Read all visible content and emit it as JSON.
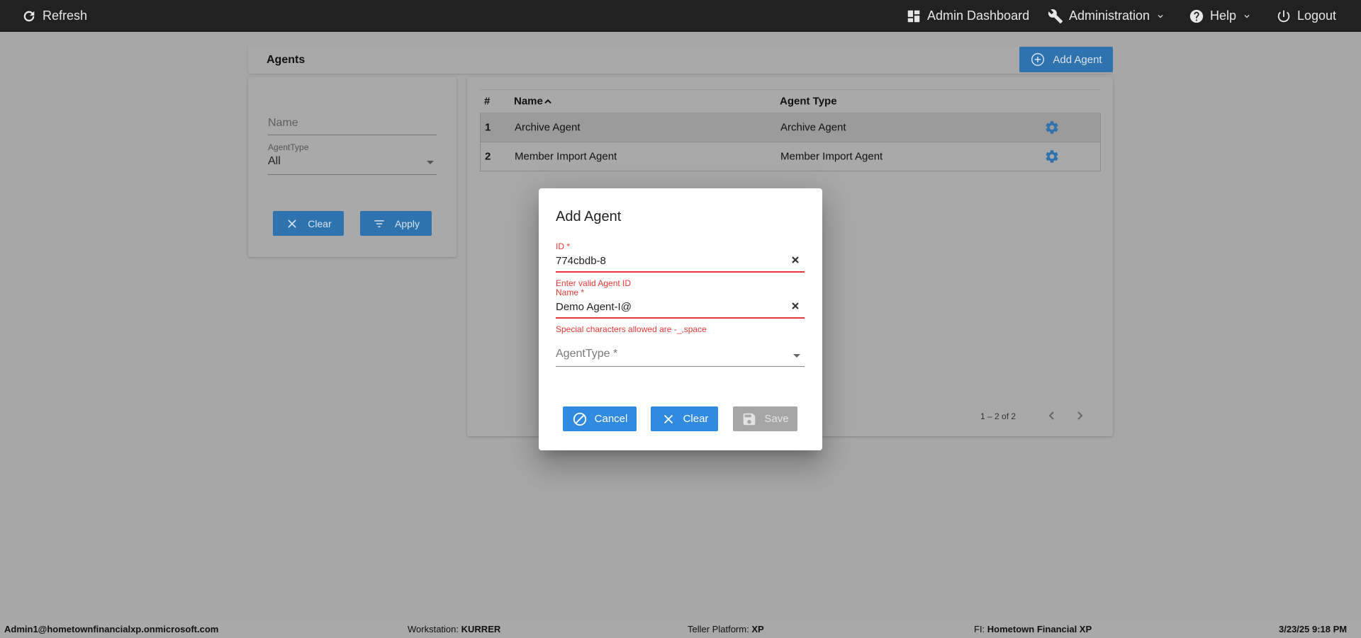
{
  "topbar": {
    "refresh": "Refresh",
    "admin_dashboard": "Admin Dashboard",
    "administration": "Administration",
    "help": "Help",
    "logout": "Logout"
  },
  "agents": {
    "title": "Agents",
    "add_button": "Add Agent"
  },
  "filters": {
    "name_placeholder": "Name",
    "agent_type_label": "AgentType",
    "agent_type_value": "All",
    "clear_button": "Clear",
    "apply_button": "Apply"
  },
  "table": {
    "columns": [
      "#",
      "Name",
      "Agent Type"
    ],
    "rows": [
      {
        "num": "1",
        "name": "Archive Agent",
        "type": "Archive Agent"
      },
      {
        "num": "2",
        "name": "Member Import Agent",
        "type": "Member Import Agent"
      }
    ],
    "sort_column": "Name",
    "sort_direction": "ascending",
    "paginator": "1 – 2 of 2"
  },
  "dialog": {
    "title": "Add Agent",
    "id_label": "ID *",
    "id_value": "774cbdb-8",
    "id_error": "Enter valid Agent ID",
    "name_label": "Name *",
    "name_value": "Demo Agent-I@",
    "name_error": "Special characters allowed are -_,space",
    "type_placeholder": "AgentType *",
    "cancel_button": "Cancel",
    "clear_button": "Clear",
    "save_button": "Save"
  },
  "footer": {
    "user": "Admin1@hometownfinancialxp.onmicrosoft.com",
    "workstation_label": "Workstation:",
    "workstation_value": "KURRER",
    "platform_label": "Teller Platform:",
    "platform_value": "XP",
    "fi_label": "FI:",
    "fi_value": "Hometown Financial XP",
    "datetime": "3/23/25 9:18 PM"
  },
  "colors": {
    "topbar": "#212121",
    "primary_button": "#2f73ae",
    "dialog_button": "#2f8ae0",
    "error": "#e53935"
  }
}
